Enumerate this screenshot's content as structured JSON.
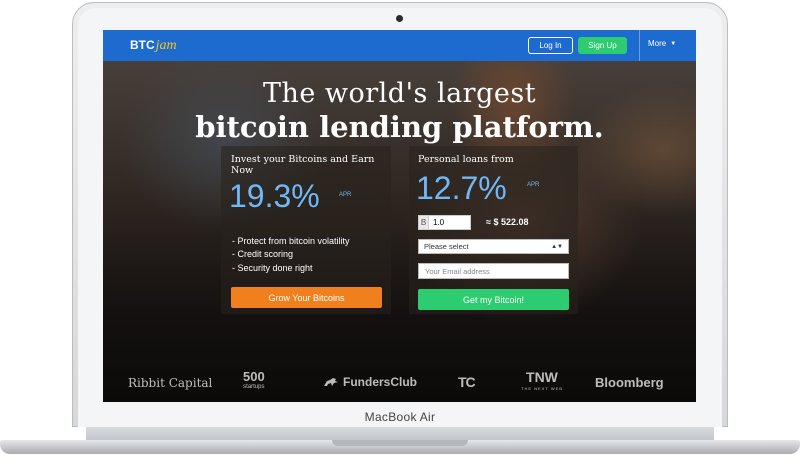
{
  "device": {
    "model_label": "MacBook Air"
  },
  "header": {
    "logo_btc": "BTC",
    "logo_jam": "jam",
    "login_label": "Log In",
    "signup_label": "Sign Up",
    "more_label": "More"
  },
  "hero": {
    "headline_line1": "The world's largest",
    "headline_line2": "bitcoin lending platform."
  },
  "invest": {
    "title": "Invest your Bitcoins and Earn Now",
    "rate": "19.3%",
    "rate_suffix": "APR",
    "bullets": [
      "- Protect from bitcoin volatility",
      "- Credit scoring",
      "- Security done right"
    ],
    "button_label": "Grow Your Bitcoins"
  },
  "loan": {
    "title": "Personal loans from",
    "rate": "12.7%",
    "rate_suffix": "APR",
    "btc_symbol": "B",
    "btc_amount": "1.0",
    "usd_equiv": "≈ $ 522.08",
    "select_value": "Please select",
    "email_placeholder": "Your Email address",
    "button_label": "Get my Bitcoin!"
  },
  "partners": {
    "ribbit": "Ribbit Capital",
    "startups_top": "500",
    "startups_bottom": "startups",
    "fundersclub": "FundersClub",
    "techcrunch": "TC",
    "tnw_top": "TNW",
    "tnw_bottom": "THE NEXT WEB",
    "bloomberg": "Bloomberg"
  },
  "colors": {
    "nav_blue": "#1e6bd0",
    "signup_green": "#2ecc71",
    "invest_orange": "#f0801e",
    "rate_blue": "#6fb8f5"
  }
}
